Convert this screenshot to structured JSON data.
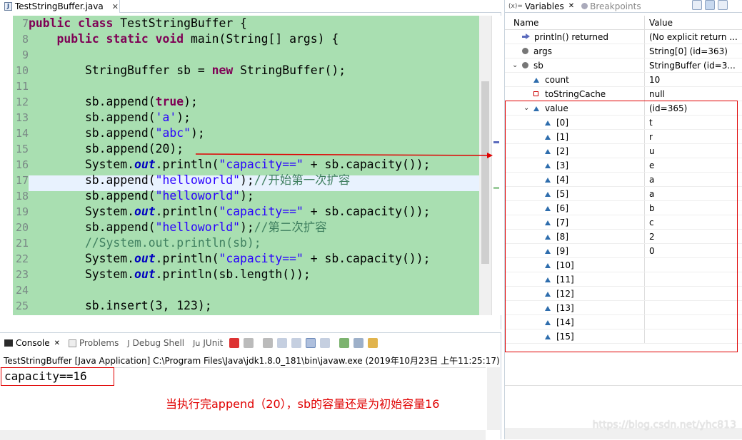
{
  "editor": {
    "tab_label": "TestStringBuffer.java",
    "tab_close": "✕",
    "lines": [
      {
        "n": "7",
        "parts": [
          {
            "t": "public class ",
            "c": "kw"
          },
          {
            "t": "TestStringBuffer {",
            "c": ""
          }
        ]
      },
      {
        "n": "8",
        "parts": [
          {
            "t": "    ",
            "c": ""
          },
          {
            "t": "public static void ",
            "c": "kw"
          },
          {
            "t": "main(String[] args) {",
            "c": ""
          }
        ]
      },
      {
        "n": "9",
        "parts": []
      },
      {
        "n": "10",
        "parts": [
          {
            "t": "        StringBuffer sb = ",
            "c": ""
          },
          {
            "t": "new ",
            "c": "kw"
          },
          {
            "t": "StringBuffer();",
            "c": ""
          }
        ]
      },
      {
        "n": "11",
        "parts": []
      },
      {
        "n": "12",
        "parts": [
          {
            "t": "        sb.append(",
            "c": ""
          },
          {
            "t": "true",
            "c": "kw"
          },
          {
            "t": ");",
            "c": ""
          }
        ]
      },
      {
        "n": "13",
        "parts": [
          {
            "t": "        sb.append(",
            "c": ""
          },
          {
            "t": "'a'",
            "c": "str"
          },
          {
            "t": ");",
            "c": ""
          }
        ]
      },
      {
        "n": "14",
        "parts": [
          {
            "t": "        sb.append(",
            "c": ""
          },
          {
            "t": "\"abc\"",
            "c": "str"
          },
          {
            "t": ");",
            "c": ""
          }
        ]
      },
      {
        "n": "15",
        "parts": [
          {
            "t": "        sb.append(20);",
            "c": ""
          }
        ]
      },
      {
        "n": "16",
        "parts": [
          {
            "t": "        System.",
            "c": ""
          },
          {
            "t": "out",
            "c": "fld"
          },
          {
            "t": ".println(",
            "c": ""
          },
          {
            "t": "\"capacity==\"",
            "c": "str"
          },
          {
            "t": " + sb.capacity());",
            "c": ""
          }
        ]
      },
      {
        "n": "17",
        "parts": [
          {
            "t": "        sb.append(",
            "c": ""
          },
          {
            "t": "\"helloworld\"",
            "c": "str"
          },
          {
            "t": ");",
            "c": ""
          },
          {
            "t": "//开始第一次扩容",
            "c": "cmt"
          }
        ]
      },
      {
        "n": "18",
        "parts": [
          {
            "t": "        sb.append(",
            "c": ""
          },
          {
            "t": "\"helloworld\"",
            "c": "str"
          },
          {
            "t": ");",
            "c": ""
          }
        ]
      },
      {
        "n": "19",
        "parts": [
          {
            "t": "        System.",
            "c": ""
          },
          {
            "t": "out",
            "c": "fld"
          },
          {
            "t": ".println(",
            "c": ""
          },
          {
            "t": "\"capacity==\"",
            "c": "str"
          },
          {
            "t": " + sb.capacity());",
            "c": ""
          }
        ]
      },
      {
        "n": "20",
        "parts": [
          {
            "t": "        sb.append(",
            "c": ""
          },
          {
            "t": "\"helloworld\"",
            "c": "str"
          },
          {
            "t": ");",
            "c": ""
          },
          {
            "t": "//第二次扩容",
            "c": "cmt"
          }
        ]
      },
      {
        "n": "21",
        "parts": [
          {
            "t": "        //System.out.println(sb);",
            "c": "cmt"
          }
        ]
      },
      {
        "n": "22",
        "parts": [
          {
            "t": "        System.",
            "c": ""
          },
          {
            "t": "out",
            "c": "fld"
          },
          {
            "t": ".println(",
            "c": ""
          },
          {
            "t": "\"capacity==\"",
            "c": "str"
          },
          {
            "t": " + sb.capacity());",
            "c": ""
          }
        ]
      },
      {
        "n": "23",
        "parts": [
          {
            "t": "        System.",
            "c": ""
          },
          {
            "t": "out",
            "c": "fld"
          },
          {
            "t": ".println(sb.length());",
            "c": ""
          }
        ]
      },
      {
        "n": "24",
        "parts": []
      },
      {
        "n": "25",
        "parts": [
          {
            "t": "        sb.insert(3, 123);",
            "c": ""
          }
        ]
      }
    ]
  },
  "console": {
    "tabs": [
      {
        "label": "Console",
        "close": "✕",
        "active": true
      },
      {
        "label": "Problems",
        "active": false
      },
      {
        "label": "Debug Shell",
        "active": false
      },
      {
        "label": "JUnit",
        "active": false
      }
    ],
    "header": "TestStringBuffer [Java Application] C:\\Program Files\\Java\\jdk1.8.0_181\\bin\\javaw.exe (2019年10月23日 上午11:25:17)",
    "output": "capacity==16",
    "annotation": "当执行完append（20），sb的容量还是为初始容量16"
  },
  "variables": {
    "tab_label": "Variables",
    "tab_close": "✕",
    "tab2_label": "Breakpoints",
    "col_name": "Name",
    "col_value": "Value",
    "rows": [
      {
        "name": "println() returned",
        "value": "(No explicit return ...",
        "icon": "arrow",
        "indent": 0
      },
      {
        "name": "args",
        "value": "String[0]  (id=363)",
        "icon": "dot",
        "indent": 0
      },
      {
        "name": "sb",
        "value": "StringBuffer  (id=3...",
        "icon": "dot",
        "indent": 0,
        "expanded": true
      },
      {
        "name": "count",
        "value": "10",
        "icon": "tri",
        "indent": 1
      },
      {
        "name": "toStringCache",
        "value": "null",
        "icon": "sq",
        "indent": 1
      },
      {
        "name": "value",
        "value": "(id=365)",
        "icon": "tri",
        "indent": 1,
        "expanded": true
      },
      {
        "name": "[0]",
        "value": "t",
        "icon": "tri",
        "indent": 2
      },
      {
        "name": "[1]",
        "value": "r",
        "icon": "tri",
        "indent": 2
      },
      {
        "name": "[2]",
        "value": "u",
        "icon": "tri",
        "indent": 2
      },
      {
        "name": "[3]",
        "value": "e",
        "icon": "tri",
        "indent": 2
      },
      {
        "name": "[4]",
        "value": "a",
        "icon": "tri",
        "indent": 2
      },
      {
        "name": "[5]",
        "value": "a",
        "icon": "tri",
        "indent": 2
      },
      {
        "name": "[6]",
        "value": "b",
        "icon": "tri",
        "indent": 2
      },
      {
        "name": "[7]",
        "value": "c",
        "icon": "tri",
        "indent": 2
      },
      {
        "name": "[8]",
        "value": "2",
        "icon": "tri",
        "indent": 2
      },
      {
        "name": "[9]",
        "value": "0",
        "icon": "tri",
        "indent": 2
      },
      {
        "name": "[10]",
        "value": "",
        "icon": "tri",
        "indent": 2
      },
      {
        "name": "[11]",
        "value": "",
        "icon": "tri",
        "indent": 2
      },
      {
        "name": "[12]",
        "value": "",
        "icon": "tri",
        "indent": 2
      },
      {
        "name": "[13]",
        "value": "",
        "icon": "tri",
        "indent": 2
      },
      {
        "name": "[14]",
        "value": "",
        "icon": "tri",
        "indent": 2
      },
      {
        "name": "[15]",
        "value": "",
        "icon": "tri",
        "indent": 2
      }
    ]
  },
  "watermark": "https://blog.csdn.net/yhc813"
}
